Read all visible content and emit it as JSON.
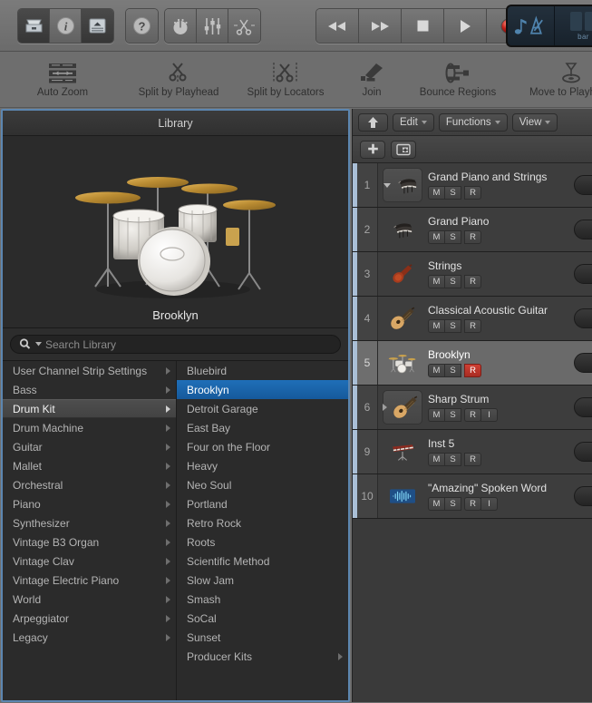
{
  "toolbar": {
    "groups": [
      {
        "name": "view-toggles",
        "buttons": [
          {
            "icon": "library-icon",
            "label": "Library",
            "state": "on"
          },
          {
            "icon": "info-icon",
            "label": "Inspector",
            "state": "off"
          },
          {
            "icon": "editor-icon",
            "label": "Editors",
            "state": "on"
          }
        ]
      },
      {
        "name": "help-group",
        "buttons": [
          {
            "icon": "help-icon",
            "label": "Quick Help",
            "state": "off"
          }
        ]
      },
      {
        "name": "panel-group",
        "buttons": [
          {
            "icon": "smart-controls-icon",
            "label": "Smart Controls",
            "state": "off"
          },
          {
            "icon": "mixer-icon",
            "label": "Mixer",
            "state": "off"
          },
          {
            "icon": "editors-scissors-icon",
            "label": "Editors",
            "state": "off"
          }
        ]
      },
      {
        "name": "transport",
        "buttons": [
          {
            "icon": "rewind-icon",
            "label": "Rewind",
            "state": "off"
          },
          {
            "icon": "forward-icon",
            "label": "Forward",
            "state": "off"
          },
          {
            "icon": "stop-icon",
            "label": "Stop",
            "state": "off"
          },
          {
            "icon": "play-icon",
            "label": "Play",
            "state": "off"
          },
          {
            "icon": "record-icon",
            "label": "Record",
            "state": "off"
          }
        ]
      }
    ],
    "lcd": {
      "mode_icons": "note-metronome-icon",
      "digits": [
        "",
        ""
      ],
      "unit": "bar"
    }
  },
  "toolbar2": {
    "items": [
      {
        "label": "Auto Zoom",
        "icon": "auto-zoom-icon"
      },
      {
        "label": "Split by Playhead",
        "icon": "scissors-playhead-icon"
      },
      {
        "label": "Split by Locators",
        "icon": "scissors-locators-icon"
      },
      {
        "label": "Join",
        "icon": "glue-icon"
      },
      {
        "label": "Bounce Regions",
        "icon": "bounce-icon"
      },
      {
        "label": "Move to Playhead",
        "icon": "move-playhead-icon"
      }
    ]
  },
  "library": {
    "title": "Library",
    "preview_label": "Brooklyn",
    "preview_image": "drum-kit-photo",
    "search": {
      "placeholder": "Search Library",
      "value": ""
    },
    "column1": [
      {
        "label": "User Channel Strip Settings",
        "has_arrow": true,
        "selected": false
      },
      {
        "label": "Bass",
        "has_arrow": true,
        "selected": false
      },
      {
        "label": "Drum Kit",
        "has_arrow": true,
        "selected": true
      },
      {
        "label": "Drum Machine",
        "has_arrow": true,
        "selected": false
      },
      {
        "label": "Guitar",
        "has_arrow": true,
        "selected": false
      },
      {
        "label": "Mallet",
        "has_arrow": true,
        "selected": false
      },
      {
        "label": "Orchestral",
        "has_arrow": true,
        "selected": false
      },
      {
        "label": "Piano",
        "has_arrow": true,
        "selected": false
      },
      {
        "label": "Synthesizer",
        "has_arrow": true,
        "selected": false
      },
      {
        "label": "Vintage B3 Organ",
        "has_arrow": true,
        "selected": false
      },
      {
        "label": "Vintage Clav",
        "has_arrow": true,
        "selected": false
      },
      {
        "label": "Vintage Electric Piano",
        "has_arrow": true,
        "selected": false
      },
      {
        "label": "World",
        "has_arrow": true,
        "selected": false
      },
      {
        "label": "Arpeggiator",
        "has_arrow": true,
        "selected": false
      },
      {
        "label": "Legacy",
        "has_arrow": true,
        "selected": false
      }
    ],
    "column2": [
      {
        "label": "Bluebird",
        "has_arrow": false,
        "selected": false
      },
      {
        "label": "Brooklyn",
        "has_arrow": false,
        "selected": true
      },
      {
        "label": "Detroit Garage",
        "has_arrow": false,
        "selected": false
      },
      {
        "label": "East Bay",
        "has_arrow": false,
        "selected": false
      },
      {
        "label": "Four on the Floor",
        "has_arrow": false,
        "selected": false
      },
      {
        "label": "Heavy",
        "has_arrow": false,
        "selected": false
      },
      {
        "label": "Neo Soul",
        "has_arrow": false,
        "selected": false
      },
      {
        "label": "Portland",
        "has_arrow": false,
        "selected": false
      },
      {
        "label": "Retro Rock",
        "has_arrow": false,
        "selected": false
      },
      {
        "label": "Roots",
        "has_arrow": false,
        "selected": false
      },
      {
        "label": "Scientific Method",
        "has_arrow": false,
        "selected": false
      },
      {
        "label": "Slow Jam",
        "has_arrow": false,
        "selected": false
      },
      {
        "label": "Smash",
        "has_arrow": false,
        "selected": false
      },
      {
        "label": "SoCal",
        "has_arrow": false,
        "selected": false
      },
      {
        "label": "Sunset",
        "has_arrow": false,
        "selected": false
      },
      {
        "label": "Producer Kits",
        "has_arrow": true,
        "selected": false
      }
    ]
  },
  "tracks": {
    "menubar": {
      "up_button": "up-arrow-icon",
      "edit": "Edit",
      "functions": "Functions",
      "view": "View"
    },
    "subbar": {
      "add_track": "add-track-icon",
      "duplicate_track": "duplicate-track-icon"
    },
    "buttons": {
      "mute": "M",
      "solo": "S",
      "record": "R",
      "input": "I"
    },
    "rows": [
      {
        "num": "1",
        "name": "Grand Piano and Strings",
        "icon": "grand-piano-icon",
        "disclosure": "down",
        "framed": true,
        "selected": false,
        "buttons": [
          "M",
          "S",
          "R"
        ],
        "record_on": false
      },
      {
        "num": "2",
        "name": "Grand Piano",
        "icon": "grand-piano-icon",
        "disclosure": "none",
        "framed": false,
        "selected": false,
        "buttons": [
          "M",
          "S",
          "R"
        ],
        "record_on": false
      },
      {
        "num": "3",
        "name": "Strings",
        "icon": "violin-icon",
        "disclosure": "none",
        "framed": false,
        "selected": false,
        "buttons": [
          "M",
          "S",
          "R"
        ],
        "record_on": false
      },
      {
        "num": "4",
        "name": "Classical Acoustic Guitar",
        "icon": "acoustic-guitar-icon",
        "disclosure": "none",
        "framed": false,
        "selected": false,
        "buttons": [
          "M",
          "S",
          "R"
        ],
        "record_on": false
      },
      {
        "num": "5",
        "name": "Brooklyn",
        "icon": "drum-kit-icon",
        "disclosure": "none",
        "framed": false,
        "selected": true,
        "buttons": [
          "M",
          "S",
          "R"
        ],
        "record_on": true
      },
      {
        "num": "6",
        "name": "Sharp Strum",
        "icon": "acoustic-guitar-icon",
        "disclosure": "right",
        "framed": true,
        "selected": false,
        "buttons": [
          "M",
          "S",
          "R",
          "I"
        ],
        "record_on": false
      },
      {
        "num": "9",
        "name": "Inst 5",
        "icon": "keyboard-icon",
        "disclosure": "none",
        "framed": false,
        "selected": false,
        "buttons": [
          "M",
          "S",
          "R"
        ],
        "record_on": false
      },
      {
        "num": "10",
        "name": "\"Amazing\" Spoken Word",
        "icon": "audio-waveform-icon",
        "disclosure": "none",
        "framed": false,
        "selected": false,
        "buttons": [
          "M",
          "S",
          "R",
          "I"
        ],
        "record_on": false
      }
    ]
  },
  "colors": {
    "accent_blue": "#1f6fb8",
    "focus_border": "#5c86b0",
    "record_red": "#cf4034",
    "track_color": "#aabfd6",
    "toolbar_bg": "#6e6e6e",
    "panel_bg": "#2b2b2b"
  }
}
